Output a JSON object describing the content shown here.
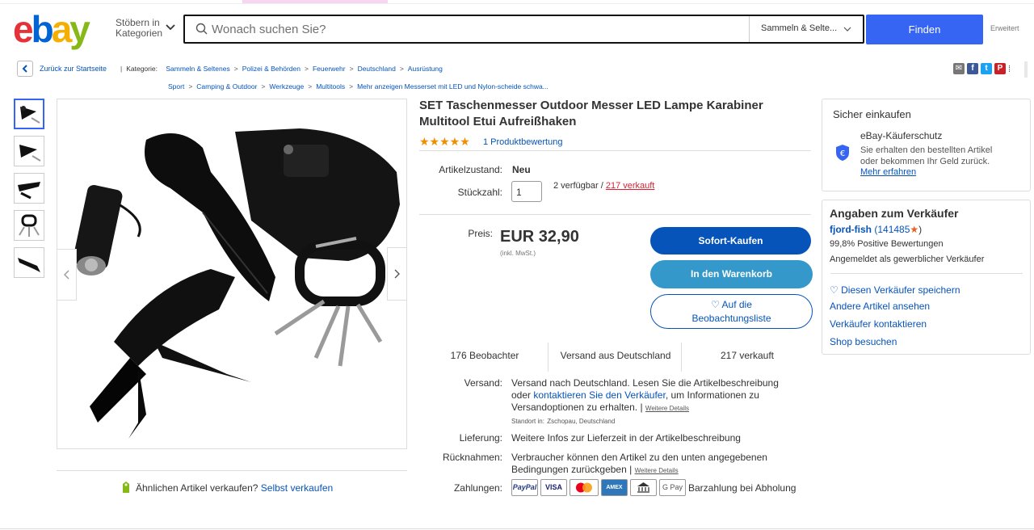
{
  "header": {
    "logo_letters": [
      "e",
      "b",
      "a",
      "y"
    ],
    "browse_label_1": "Stöbern in",
    "browse_label_2": "Kategorien",
    "search_placeholder": "Wonach suchen Sie?",
    "category_selected": "Sammeln & Selte...",
    "find_label": "Finden",
    "advanced_label": "Erweitert"
  },
  "breadcrumb": {
    "back_label": "Zurück zur Startseite",
    "category_label": "Kategorie:",
    "row1": [
      "Sammeln & Seltenes",
      "Polizei & Behörden",
      "Feuerwehr",
      "Deutschland",
      "Ausrüstung"
    ],
    "row2": [
      "Sport",
      "Camping & Outdoor",
      "Werkzeuge",
      "Multitools",
      "Mehr anzeigen Messerset mit LED und Nylon-scheide schwa..."
    ]
  },
  "product": {
    "title": "SET Taschenmesser Outdoor Messer LED Lampe Karabiner Multitool Etui Aufreißhaken",
    "rating_stars": "★★★★★",
    "reviews_label": "1 Produktbewertung",
    "condition_label": "Artikelzustand:",
    "condition_value": "Neu",
    "quantity_label": "Stückzahl:",
    "quantity_value": "1",
    "available": "2 verfügbar /",
    "sold_link": "217 verkauft",
    "price_label": "Preis:",
    "price": "EUR 32,90",
    "vat": "(inkl. MwSt.)",
    "buy_now": "Sofort-Kaufen",
    "add_cart": "In den Warenkorb",
    "watch_1": "♡ Auf die",
    "watch_2": "Beobachtungsliste",
    "stat_watchers": "176 Beobachter",
    "stat_shipping": "Versand aus Deutschland",
    "stat_sold": "217 verkauft"
  },
  "details": {
    "shipping_label": "Versand:",
    "shipping_text_1": "Versand nach Deutschland. Lesen Sie die Artikelbeschreibung",
    "shipping_text_2a": "oder ",
    "shipping_link": "kontaktieren Sie den Verkäufer",
    "shipping_text_2b": ", um Informationen zu",
    "shipping_text_3": "Versandoptionen zu erhalten. |",
    "shipping_details": "Weitere Details",
    "location_label": "Standort in:",
    "location_value": "Zschopau, Deutschland",
    "delivery_label": "Lieferung:",
    "delivery_text": "Weitere Infos zur Lieferzeit in der Artikelbeschreibung",
    "returns_label": "Rücknahmen:",
    "returns_text_1": "Verbraucher können den Artikel zu den unten angegebenen",
    "returns_text_2": "Bedingungen zurückgeben |",
    "returns_details": "Weitere Details",
    "payments_label": "Zahlungen:",
    "payment_methods": [
      "PayPal",
      "VISA",
      "",
      "AMEX",
      "",
      "G Pay"
    ],
    "payment_pickup": "Barzahlung bei Abholung"
  },
  "sell": {
    "question": "Ähnlichen Artikel verkaufen?",
    "link": "Selbst verkaufen"
  },
  "buyer_protection": {
    "title": "Sicher einkaufen",
    "subtitle": "eBay-Käuferschutz",
    "text_1": "Sie erhalten den bestellten Artikel",
    "text_2": "oder bekommen Ihr Geld zurück.",
    "more": "Mehr erfahren"
  },
  "seller": {
    "title": "Angaben zum Verkäufer",
    "name": "fjord-fish",
    "score": "(141485",
    "score_close": ")",
    "positive": "99,8% Positive Bewertungen",
    "type": "Angemeldet als gewerblicher Verkäufer",
    "save": "Diesen Verkäufer speichern",
    "other_items": "Andere Artikel ansehen",
    "contact": "Verkäufer kontaktieren",
    "shop": "Shop besuchen"
  },
  "colors": {
    "primary_blue": "#3665f3",
    "link_blue": "#0654ba",
    "cart_blue": "#3498ca",
    "sold_red": "#dd1e31",
    "star_orange": "#f18e00"
  }
}
